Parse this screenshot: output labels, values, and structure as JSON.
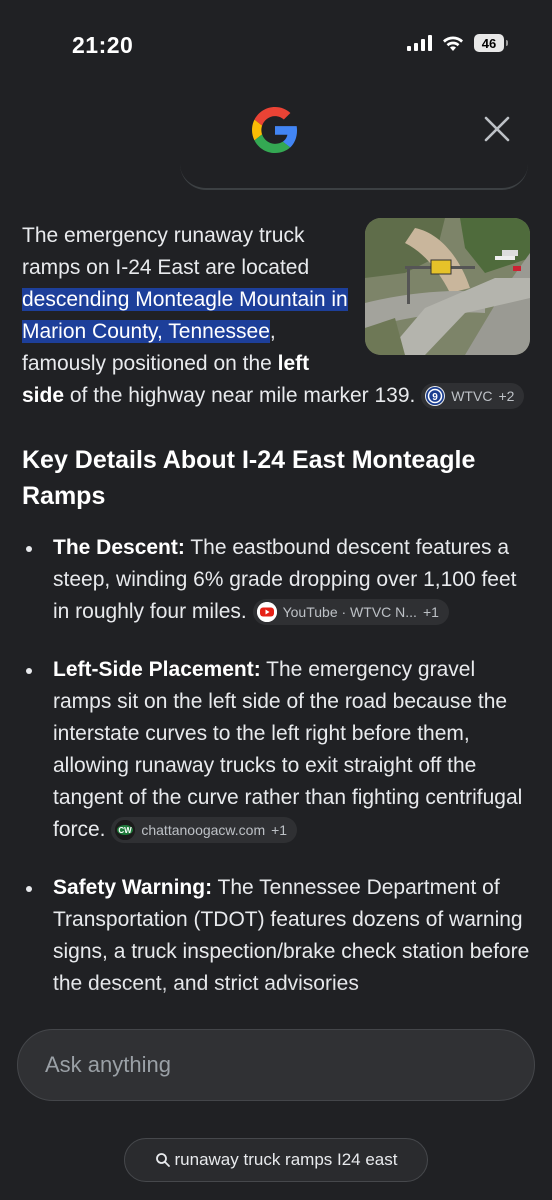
{
  "status_bar": {
    "time": "21:20",
    "battery": "46"
  },
  "answer": {
    "intro": "The emergency runaway truck ramps on I-24 East are located ",
    "highlight": "descending Monteagle Mountain in Marion County, Tennessee",
    "after_highlight": ", famously positioned on the ",
    "bold": "left side",
    "after_bold": " of the highway near mile marker 139. ",
    "source_chip": {
      "label": "WTVC",
      "extra": "+2",
      "icon": "wtvc-9-logo"
    }
  },
  "section_title": "Key Details About I-24 East Monteagle Ramps",
  "bullets": [
    {
      "title": "The Descent:",
      "text": " The eastbound descent features a steep, winding 6% grade dropping over 1,100 feet in roughly four miles. ",
      "chip": {
        "label": "YouTube · WTVC N...",
        "extra": "+1",
        "icon": "youtube-icon"
      }
    },
    {
      "title": "Left-Side Placement:",
      "text": " The emergency gravel ramps sit on the left side of the road because the interstate curves to the left right before them, allowing runaway trucks to exit straight off the tangent of the curve rather than fighting centrifugal force. ",
      "chip": {
        "label": "chattanoogacw.com",
        "extra": "+1",
        "icon": "cw-logo"
      }
    },
    {
      "title": "Safety Warning:",
      "text": " The Tennessee Department of Transportation (TDOT) features dozens of warning signs, a truck inspection/brake check station before the descent, and strict advisories",
      "chip": null
    }
  ],
  "ask_box": {
    "placeholder": "Ask anything"
  },
  "suggestion": {
    "label": "runaway truck ramps I24 east",
    "icon": "search-icon"
  },
  "colors": {
    "background": "#202124",
    "highlight": "#1d3f9a",
    "chip": "#2f3033"
  }
}
